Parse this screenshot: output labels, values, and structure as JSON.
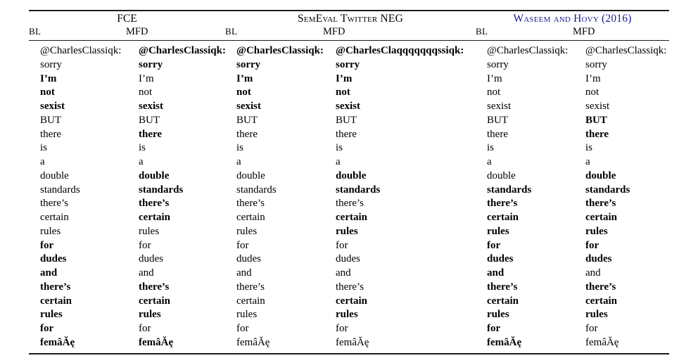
{
  "table": {
    "group_headers": [
      {
        "label": "FCE",
        "style": "plain",
        "span": 2
      },
      {
        "label": "SemEval Twitter NEG",
        "style": "smallcaps",
        "span": 2
      },
      {
        "label": "Waseem and Hovy (2016)",
        "style": "smallcaps-cite",
        "span": 2
      }
    ],
    "sub_headers": [
      "BL",
      "MFD",
      "BL",
      "MFD",
      "BL",
      "MFD"
    ],
    "cite_color": "#1b1b8f",
    "rule_color": "#1c1c1c",
    "columns": [
      {
        "id": "fce-bl",
        "group": "FCE",
        "variant": "BL",
        "tokens": [
          {
            "text": "@CharlesClassiqk:",
            "bold": false
          },
          {
            "text": "sorry",
            "bold": false
          },
          {
            "text": "I’m",
            "bold": true
          },
          {
            "text": "not",
            "bold": true
          },
          {
            "text": "sexist",
            "bold": true
          },
          {
            "text": "BUT",
            "bold": false
          },
          {
            "text": "there",
            "bold": false
          },
          {
            "text": "is",
            "bold": false
          },
          {
            "text": "a",
            "bold": false
          },
          {
            "text": "double",
            "bold": false
          },
          {
            "text": "standards",
            "bold": false
          },
          {
            "text": "there’s",
            "bold": false
          },
          {
            "text": "certain",
            "bold": false
          },
          {
            "text": "rules",
            "bold": false
          },
          {
            "text": "for",
            "bold": true
          },
          {
            "text": "dudes",
            "bold": true
          },
          {
            "text": "and",
            "bold": true
          },
          {
            "text": "there’s",
            "bold": true
          },
          {
            "text": "certain",
            "bold": true
          },
          {
            "text": "rules",
            "bold": true
          },
          {
            "text": "for",
            "bold": true
          },
          {
            "text": "femâĂę",
            "bold": true
          }
        ]
      },
      {
        "id": "fce-mfd",
        "group": "FCE",
        "variant": "MFD",
        "tokens": [
          {
            "text": "@CharlesClassiqk:",
            "bold": true
          },
          {
            "text": "sorry",
            "bold": true
          },
          {
            "text": "I’m",
            "bold": false
          },
          {
            "text": "not",
            "bold": false
          },
          {
            "text": "sexist",
            "bold": true
          },
          {
            "text": "BUT",
            "bold": false
          },
          {
            "text": "there",
            "bold": true
          },
          {
            "text": "is",
            "bold": false
          },
          {
            "text": "a",
            "bold": false
          },
          {
            "text": "double",
            "bold": true
          },
          {
            "text": "standards",
            "bold": true
          },
          {
            "text": "there’s",
            "bold": true
          },
          {
            "text": "certain",
            "bold": true
          },
          {
            "text": "rules",
            "bold": false
          },
          {
            "text": "for",
            "bold": false
          },
          {
            "text": "dudes",
            "bold": false
          },
          {
            "text": "and",
            "bold": false
          },
          {
            "text": "there’s",
            "bold": true
          },
          {
            "text": "certain",
            "bold": true
          },
          {
            "text": "rules",
            "bold": true
          },
          {
            "text": "for",
            "bold": false
          },
          {
            "text": "femâĂę",
            "bold": true
          }
        ]
      },
      {
        "id": "semeval-bl",
        "group": "SemEval Twitter NEG",
        "variant": "BL",
        "tokens": [
          {
            "text": "@CharlesClassiqk:",
            "bold": true
          },
          {
            "text": "sorry",
            "bold": true
          },
          {
            "text": "I’m",
            "bold": true
          },
          {
            "text": "not",
            "bold": true
          },
          {
            "text": "sexist",
            "bold": true
          },
          {
            "text": "BUT",
            "bold": false
          },
          {
            "text": "there",
            "bold": false
          },
          {
            "text": "is",
            "bold": false
          },
          {
            "text": "a",
            "bold": false
          },
          {
            "text": "double",
            "bold": false
          },
          {
            "text": "standards",
            "bold": false
          },
          {
            "text": "there’s",
            "bold": false
          },
          {
            "text": "certain",
            "bold": false
          },
          {
            "text": "rules",
            "bold": false
          },
          {
            "text": "for",
            "bold": false
          },
          {
            "text": "dudes",
            "bold": false
          },
          {
            "text": "and",
            "bold": false
          },
          {
            "text": "there’s",
            "bold": false
          },
          {
            "text": "certain",
            "bold": false
          },
          {
            "text": "rules",
            "bold": false
          },
          {
            "text": "for",
            "bold": false
          },
          {
            "text": "femâĂę",
            "bold": false
          }
        ]
      },
      {
        "id": "semeval-mfd",
        "group": "SemEval Twitter NEG",
        "variant": "MFD",
        "tokens": [
          {
            "text": "@CharlesClaqqqqqqqssiqk:",
            "bold": true
          },
          {
            "text": "sorry",
            "bold": true
          },
          {
            "text": "I’m",
            "bold": true
          },
          {
            "text": "not",
            "bold": true
          },
          {
            "text": "sexist",
            "bold": true
          },
          {
            "text": "BUT",
            "bold": false
          },
          {
            "text": "there",
            "bold": false
          },
          {
            "text": "is",
            "bold": false
          },
          {
            "text": "a",
            "bold": false
          },
          {
            "text": "double",
            "bold": true
          },
          {
            "text": "standards",
            "bold": true
          },
          {
            "text": "there’s",
            "bold": false
          },
          {
            "text": "certain",
            "bold": true
          },
          {
            "text": "rules",
            "bold": true
          },
          {
            "text": "for",
            "bold": false
          },
          {
            "text": "dudes",
            "bold": false
          },
          {
            "text": "and",
            "bold": false
          },
          {
            "text": "there’s",
            "bold": false
          },
          {
            "text": "certain",
            "bold": true
          },
          {
            "text": "rules",
            "bold": true
          },
          {
            "text": "for",
            "bold": false
          },
          {
            "text": "femâĂę",
            "bold": false
          }
        ]
      },
      {
        "id": "waseem-bl",
        "group": "Waseem and Hovy (2016)",
        "variant": "BL",
        "tokens": [
          {
            "text": "@CharlesClassiqk:",
            "bold": false
          },
          {
            "text": "sorry",
            "bold": false
          },
          {
            "text": "I’m",
            "bold": false
          },
          {
            "text": "not",
            "bold": false
          },
          {
            "text": "sexist",
            "bold": false
          },
          {
            "text": "BUT",
            "bold": false
          },
          {
            "text": "there",
            "bold": false
          },
          {
            "text": "is",
            "bold": false
          },
          {
            "text": "a",
            "bold": false
          },
          {
            "text": "double",
            "bold": false
          },
          {
            "text": "standards",
            "bold": true
          },
          {
            "text": "there’s",
            "bold": true
          },
          {
            "text": "certain",
            "bold": true
          },
          {
            "text": "rules",
            "bold": true
          },
          {
            "text": "for",
            "bold": true
          },
          {
            "text": "dudes",
            "bold": true
          },
          {
            "text": "and",
            "bold": true
          },
          {
            "text": "there’s",
            "bold": true
          },
          {
            "text": "certain",
            "bold": true
          },
          {
            "text": "rules",
            "bold": true
          },
          {
            "text": "for",
            "bold": true
          },
          {
            "text": "femâĂę",
            "bold": true
          }
        ]
      },
      {
        "id": "waseem-mfd",
        "group": "Waseem and Hovy (2016)",
        "variant": "MFD",
        "tokens": [
          {
            "text": "@CharlesClassiqk:",
            "bold": false
          },
          {
            "text": "sorry",
            "bold": false
          },
          {
            "text": "I’m",
            "bold": false
          },
          {
            "text": "not",
            "bold": false
          },
          {
            "text": "sexist",
            "bold": false
          },
          {
            "text": "BUT",
            "bold": true
          },
          {
            "text": "there",
            "bold": true
          },
          {
            "text": "is",
            "bold": false
          },
          {
            "text": "a",
            "bold": false
          },
          {
            "text": "double",
            "bold": true
          },
          {
            "text": "standards",
            "bold": true
          },
          {
            "text": "there’s",
            "bold": true
          },
          {
            "text": "certain",
            "bold": true
          },
          {
            "text": "rules",
            "bold": true
          },
          {
            "text": "for",
            "bold": true
          },
          {
            "text": "dudes",
            "bold": true
          },
          {
            "text": "and",
            "bold": false
          },
          {
            "text": "there’s",
            "bold": true
          },
          {
            "text": "certain",
            "bold": true
          },
          {
            "text": "rules",
            "bold": true
          },
          {
            "text": "for",
            "bold": false
          },
          {
            "text": "femâĂę",
            "bold": false
          }
        ]
      }
    ]
  }
}
